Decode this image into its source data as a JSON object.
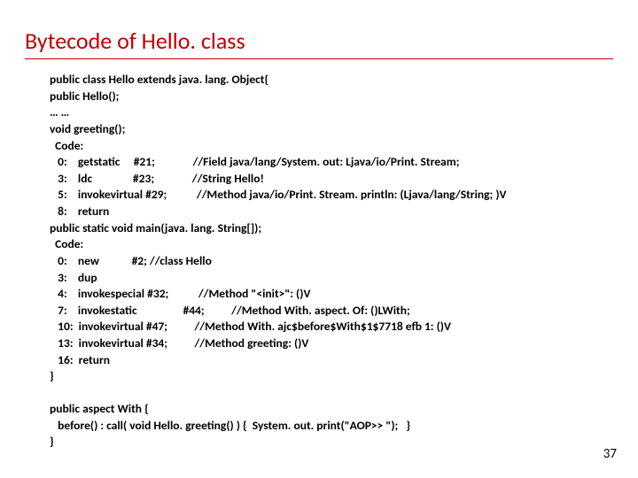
{
  "title": "Bytecode of Hello. class",
  "code1": {
    "l0": "public class Hello extends java. lang. Object{",
    "l1": "public Hello();",
    "l2": "… …",
    "l3": "void greeting();",
    "l4": "  Code:",
    "l5": "   0:    getstatic     #21;              //Field java/lang/System. out: Ljava/io/Print. Stream;",
    "l6": "   3:    ldc               #23;              //String Hello!",
    "l7": "   5:    invokevirtual #29;           //Method java/io/Print. Stream. println: (Ljava/lang/String; )V",
    "l8": "   8:    return",
    "l9": "public static void main(java. lang. String[]);",
    "l10": "  Code:",
    "l11": "   0:    new            #2; //class Hello",
    "l12": "   3:    dup",
    "l13": "   4:    invokespecial #32;           //Method \"<init>\": ()V",
    "l14": "   7:    invokestatic                 #44;          //Method With. aspect. Of: ()LWith;",
    "l15": "   10:  invokevirtual #47;          //Method With. ajc$before$With$1$7718 efb 1: ()V",
    "l16": "   13:  invokevirtual #34;          //Method greeting: ()V",
    "l17": "   16:  return",
    "l18": "}"
  },
  "code2": {
    "l0": "public aspect With {",
    "l1": "   before() : call( void Hello. greeting() ) {  System. out. print(\"AOP>> \");   }",
    "l2": "}"
  },
  "pagenum": "37"
}
